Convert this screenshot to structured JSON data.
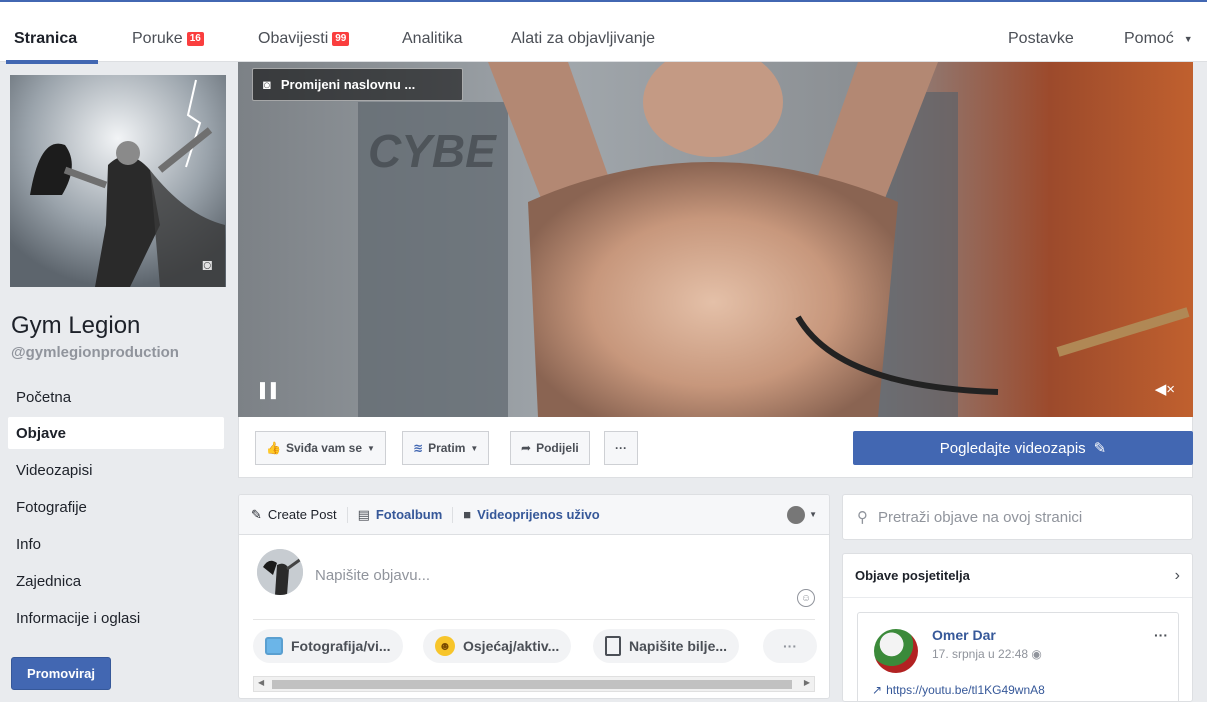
{
  "nav": {
    "items": [
      {
        "label": "Stranica"
      },
      {
        "label": "Poruke",
        "badge": "16"
      },
      {
        "label": "Obavijesti",
        "badge": "99"
      },
      {
        "label": "Analitika"
      },
      {
        "label": "Alati za objavljivanje"
      },
      {
        "label": "Postavke"
      },
      {
        "label": "Pomoć"
      }
    ]
  },
  "page": {
    "name": "Gym Legion",
    "handle": "@gymlegionproduction"
  },
  "sidebar": {
    "items": [
      {
        "label": "Početna"
      },
      {
        "label": "Objave"
      },
      {
        "label": "Videozapisi"
      },
      {
        "label": "Fotografije"
      },
      {
        "label": "Info"
      },
      {
        "label": "Zajednica"
      },
      {
        "label": "Informacije i oglasi"
      }
    ],
    "promote": "Promoviraj"
  },
  "cover": {
    "change_label": "Promijeni naslovnu ..."
  },
  "actions": {
    "like": "Sviđa vam se",
    "follow": "Pratim",
    "share": "Podijeli",
    "more": "···",
    "watch_video": "Pogledajte videozapis"
  },
  "composer": {
    "tabs": [
      "Create Post",
      "Fotoalbum",
      "Videoprijenos uživo"
    ],
    "placeholder": "Napišite objavu...",
    "chips": [
      "Fotografija/vi...",
      "Osjećaj/aktiv...",
      "Napišite bilje...",
      "···"
    ]
  },
  "search": {
    "placeholder": "Pretraži objave na ovoj stranici"
  },
  "visitor": {
    "title": "Objave posjetitelja",
    "post": {
      "author": "Omer Dar",
      "time": "17. srpnja u 22:48",
      "link": "https://youtu.be/tl1KG49wnA8"
    }
  },
  "colors": {
    "accent": "#4267b2",
    "badge": "#fa3e3e",
    "link": "#365899"
  }
}
